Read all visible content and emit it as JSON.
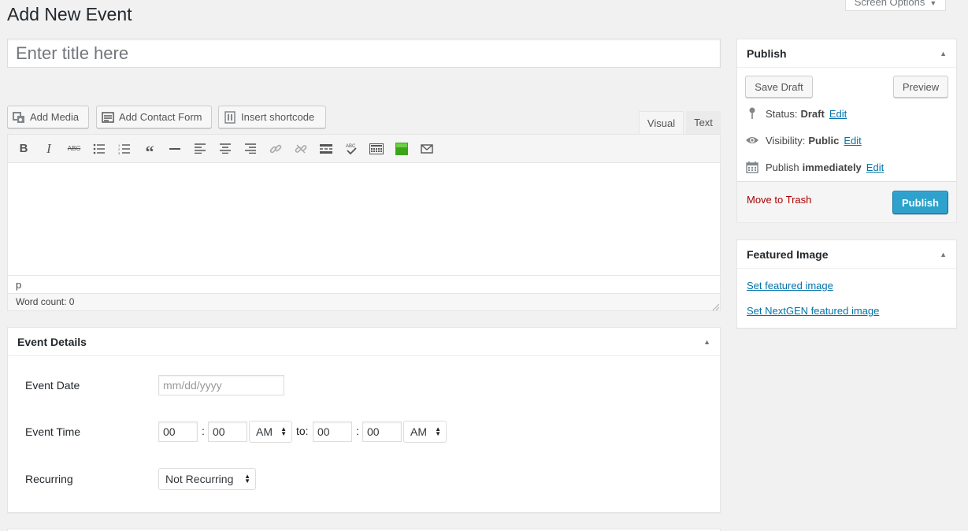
{
  "page": {
    "title": "Add New Event",
    "screen_options": "Screen Options"
  },
  "title_field": {
    "placeholder": "Enter title here"
  },
  "media_buttons": {
    "add_media": "Add Media",
    "add_contact_form": "Add Contact Form",
    "insert_shortcode": "Insert shortcode"
  },
  "editor": {
    "tabs": {
      "visual": "Visual",
      "text": "Text"
    },
    "path": "p",
    "word_count": "Word count: 0",
    "toolbar_icons": [
      "bold-icon",
      "italic-icon",
      "strikethrough-icon",
      "bullet-list-icon",
      "numbered-list-icon",
      "blockquote-icon",
      "horizontal-rule-icon",
      "align-left-icon",
      "align-center-icon",
      "align-right-icon",
      "link-icon",
      "unlink-icon",
      "read-more-icon",
      "spellcheck-icon",
      "toolbar-toggle-icon",
      "green-square-icon",
      "envelope-icon"
    ]
  },
  "event_details": {
    "heading": "Event Details",
    "date_label": "Event Date",
    "date_placeholder": "mm/dd/yyyy",
    "time_label": "Event Time",
    "start_hour": "00",
    "start_minute": "00",
    "start_ampm": "AM",
    "to_label": "to:",
    "end_hour": "00",
    "end_minute": "00",
    "end_ampm": "AM",
    "colon": ":",
    "recurring_label": "Recurring",
    "recurring_value": "Not Recurring"
  },
  "publish": {
    "heading": "Publish",
    "save_draft": "Save Draft",
    "preview": "Preview",
    "status_label": "Status:",
    "status_value": "Draft",
    "visibility_label": "Visibility:",
    "visibility_value": "Public",
    "publish_label": "Publish",
    "publish_value": "immediately",
    "edit": "Edit",
    "move_to_trash": "Move to Trash",
    "publish_button": "Publish"
  },
  "featured_image": {
    "heading": "Featured Image",
    "set_featured": "Set featured image",
    "set_nextgen": "Set NextGEN featured image"
  },
  "colors": {
    "primary_button": "#2ea2cc",
    "link": "#0073aa",
    "trash": "#a00"
  }
}
